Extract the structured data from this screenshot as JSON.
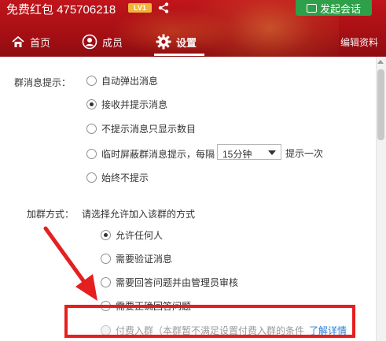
{
  "header": {
    "group_title": "免费红包 475706218",
    "level_badge": "LV1",
    "start_chat_label": "发起会话",
    "colors": {
      "header_red": "#b01218",
      "chat_green": "#2ea04a",
      "badge_orange": "#f2b43a"
    }
  },
  "tabs": [
    {
      "label": "首页",
      "icon": "home-icon"
    },
    {
      "label": "成员",
      "icon": "member-icon"
    },
    {
      "label": "设置",
      "icon": "gear-icon",
      "active": true
    },
    {
      "label": "编辑资料"
    }
  ],
  "message_prompt": {
    "label": "群消息提示：",
    "options": [
      {
        "label": "自动弹出消息",
        "checked": false
      },
      {
        "label": "接收并提示消息",
        "checked": true
      },
      {
        "label": "不提示消息只显示数目",
        "checked": false
      },
      {
        "label": "临时屏蔽群消息提示，每隔",
        "checked": false
      },
      {
        "label": "始终不提示",
        "checked": false
      }
    ],
    "interval_select_value": "15分钟",
    "interval_suffix": "提示一次"
  },
  "join_method": {
    "label": "加群方式：",
    "hint": "请选择允许加入该群的方式",
    "options": [
      {
        "label": "允许任何人",
        "checked": true
      },
      {
        "label": "需要验证消息",
        "checked": false
      },
      {
        "label": "需要回答问题并由管理员审核",
        "checked": false
      },
      {
        "label": "需要正确回答问题",
        "checked": false
      },
      {
        "label": "付费入群（本群暂不满足设置付费入群的条件",
        "checked": false,
        "disabled": true,
        "link": "了解详情"
      }
    ]
  },
  "annotation": {
    "color": "#e51f1f"
  }
}
